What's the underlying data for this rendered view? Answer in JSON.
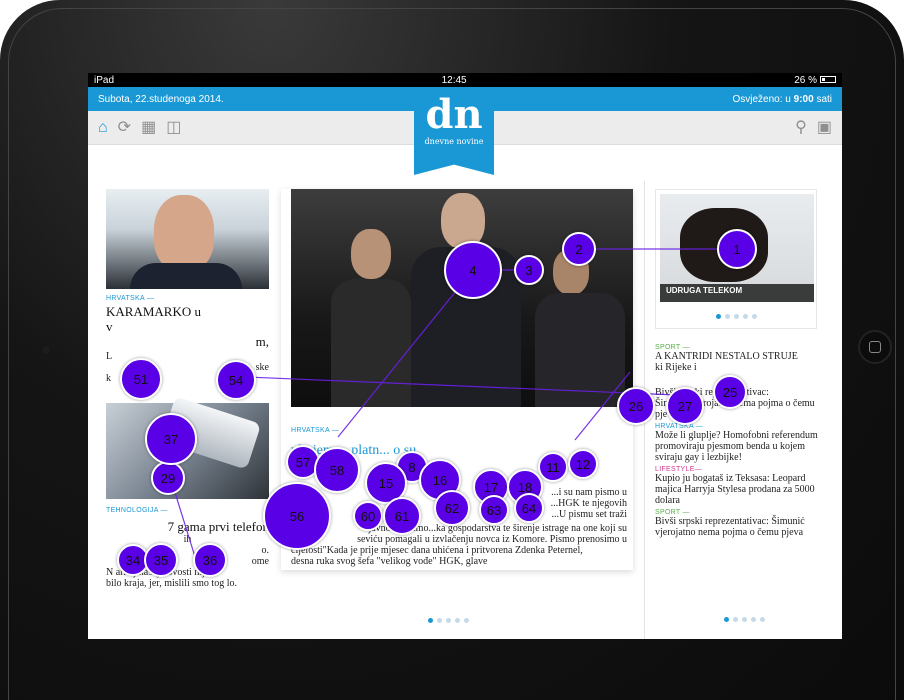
{
  "status": {
    "device": "iPad",
    "time": "12:45",
    "battery": "26 %"
  },
  "topbar": {
    "date": "Subota, 22.studenoga 2014.",
    "refreshed_label": "Osvježeno: u",
    "refreshed_time": "9:00",
    "refreshed_suffix": "sati"
  },
  "logo": {
    "big": "dn",
    "small": "dnevne novine"
  },
  "toolbar": {
    "icons": [
      "home-icon",
      "refresh-icon",
      "grid-icon",
      "book-icon"
    ],
    "right_icons": [
      "search-icon",
      "lock-icon"
    ]
  },
  "left": {
    "top_section": "HRVATSKA —",
    "top_headline": "KARAMARKO u",
    "top_headline2": "v",
    "top_headline3": "m,",
    "top_text1": "L",
    "top_text2": "ske",
    "top_text3": "k",
    "bottom_section": "TEHNOLOGIJA —",
    "bottom_line1": "7 gama prvi telefon",
    "bottom_line2": "ih",
    "bottom_line3": "o.",
    "bottom_line4": "ome",
    "bottom_line5": "N arhoj našoj novosti nije",
    "bottom_line6": "bilo kraja, jer, mislili smo tog lo."
  },
  "main": {
    "section": "HRVATSKA —",
    "headline": "vljujemo...platn... o su",
    "para1": "...i su nam pismo u",
    "para2": "...HGK te njegovih",
    "para3": "...U pismu set traži",
    "para4": "javnosti, mimo...ka gospodarstva te širenje istrage na one koji su",
    "para5": "seviću pomagali u izvlačenju novca iz Komore. Pismo prenosimo u",
    "para6": "cijelosti\"Kada je prije mjesec dana uhićena i pritvorena Zdenka Peternel,",
    "para7": "desna ruka svog šefa \"velikog vođe\" HGK, glave"
  },
  "right": {
    "caption": "UDRUGA TELEKOM",
    "items": [
      {
        "section": "SPORT —",
        "title": "A KANTRIDI NESTALO STRUJE",
        "extra": "ki        Rijeke i"
      },
      {
        "section": "",
        "title": "Bivši srpski reprezentativac:",
        "extra": "Šimunić vjerojatno nema pojma o čemu pjeva"
      },
      {
        "section": "HRVATSKA —",
        "title": "Može li gluplje? Homofobni referendum promoviraju pjesmom benda u kojem sviraju gay i lezbijke!",
        "extra": ""
      },
      {
        "section": "LIFESTYLE—",
        "title": "Kupio ju bogataš iz Teksasa: Leopard majica Harryja Stylesa prodana za 5000 dolara",
        "extra": ""
      },
      {
        "section": "SPORT —",
        "title": "Bivši srpski reprezentativac: Šimunić vjerojatno nema pojma o čemu pjeva",
        "extra": ""
      }
    ]
  },
  "heatmap": {
    "color": "#5a00e6",
    "points": [
      {
        "label": "1"
      },
      {
        "label": "2"
      },
      {
        "label": "3"
      },
      {
        "label": "4"
      },
      {
        "label": "11"
      },
      {
        "label": "12"
      },
      {
        "label": "8"
      },
      {
        "label": "15"
      },
      {
        "label": "16"
      },
      {
        "label": "17"
      },
      {
        "label": "18"
      },
      {
        "label": "25"
      },
      {
        "label": "26"
      },
      {
        "label": "27"
      },
      {
        "label": "29"
      },
      {
        "label": "34"
      },
      {
        "label": "35"
      },
      {
        "label": "36"
      },
      {
        "label": "37"
      },
      {
        "label": "51"
      },
      {
        "label": "54"
      },
      {
        "label": "56"
      },
      {
        "label": "57"
      },
      {
        "label": "58"
      },
      {
        "label": "60"
      },
      {
        "label": "61"
      },
      {
        "label": "62"
      },
      {
        "label": "63"
      },
      {
        "label": "64"
      }
    ]
  }
}
